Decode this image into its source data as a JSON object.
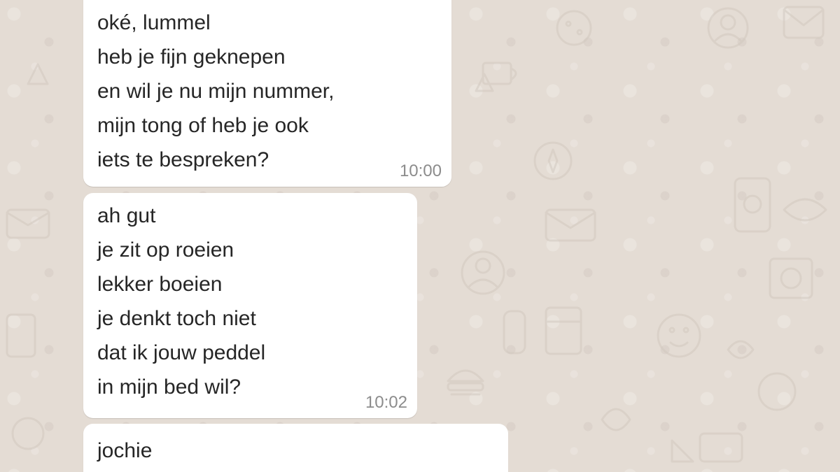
{
  "conversation": {
    "messages": [
      {
        "lines": [
          "oké, lummel",
          "heb je fijn geknepen",
          "en wil je nu mijn nummer,",
          "mijn tong of heb je ook",
          "iets te bespreken?"
        ],
        "time": "10:00"
      },
      {
        "lines": [
          "ah gut",
          "je zit op roeien",
          "lekker boeien",
          "je denkt toch niet",
          "dat ik jouw peddel",
          "in mijn bed wil?"
        ],
        "time": "10:02"
      },
      {
        "lines": [
          "jochie"
        ],
        "time": ""
      }
    ]
  },
  "colors": {
    "chat_background": "#e4dcd4",
    "bubble_background": "#ffffff",
    "message_text": "#262626",
    "timestamp_text": "#8c8c8c"
  }
}
